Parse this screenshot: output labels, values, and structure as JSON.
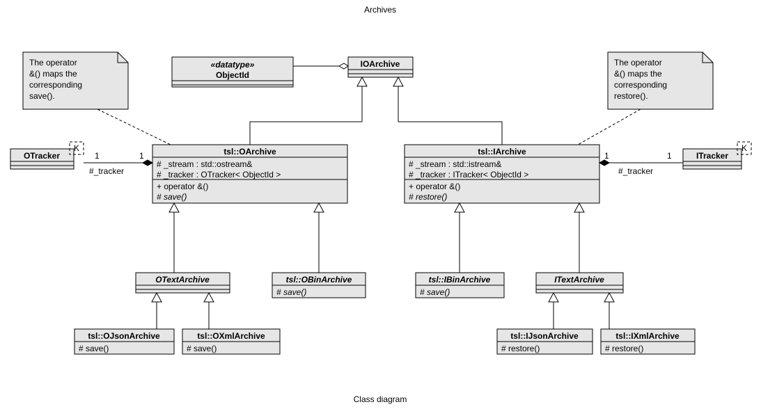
{
  "title": "Archives",
  "caption": "Class diagram",
  "notes": {
    "left": [
      "The operator",
      "&() maps the",
      "corresponding",
      "save()."
    ],
    "right": [
      "The operator",
      "&() maps the",
      "corresponding",
      "restore()."
    ]
  },
  "classes": {
    "objectid": {
      "stereo": "«datatype»",
      "name": "ObjectId"
    },
    "ioarchive": {
      "name": "IOArchive"
    },
    "otracker": {
      "name": "OTracker",
      "tparam": "K"
    },
    "itracker": {
      "name": "ITracker",
      "tparam": "K"
    },
    "oarchive": {
      "name": "tsl::OArchive",
      "attrs": [
        "# _stream : std::ostream&",
        "# _tracker : OTracker< ObjectId >"
      ],
      "ops": [
        "+ operator &()",
        "# save()"
      ]
    },
    "iarchive": {
      "name": "tsl::IArchive",
      "attrs": [
        "# _stream : std::istream&",
        "# _tracker : ITracker< ObjectId >"
      ],
      "ops": [
        "+ operator &()",
        "# restore()"
      ]
    },
    "otext": {
      "name": "OTextArchive"
    },
    "obin": {
      "name": "tsl::OBinArchive",
      "ops": [
        "# save()"
      ]
    },
    "ibin": {
      "name": "tsl::IBinArchive",
      "ops": [
        "# save()"
      ]
    },
    "itext": {
      "name": "ITextArchive"
    },
    "ojson": {
      "name": "tsl::OJsonArchive",
      "ops": [
        "# save()"
      ]
    },
    "oxml": {
      "name": "tsl::OXmlArchive",
      "ops": [
        "# save()"
      ]
    },
    "ijson": {
      "name": "tsl::IJsonArchive",
      "ops": [
        "# restore()"
      ]
    },
    "ixml": {
      "name": "tsl::IXmlArchive",
      "ops": [
        "# restore()"
      ]
    }
  },
  "assoc": {
    "left": {
      "m1": "1",
      "m2": "1",
      "role": "#_tracker"
    },
    "right": {
      "m1": "1",
      "m2": "1",
      "role": "#_tracker"
    }
  }
}
